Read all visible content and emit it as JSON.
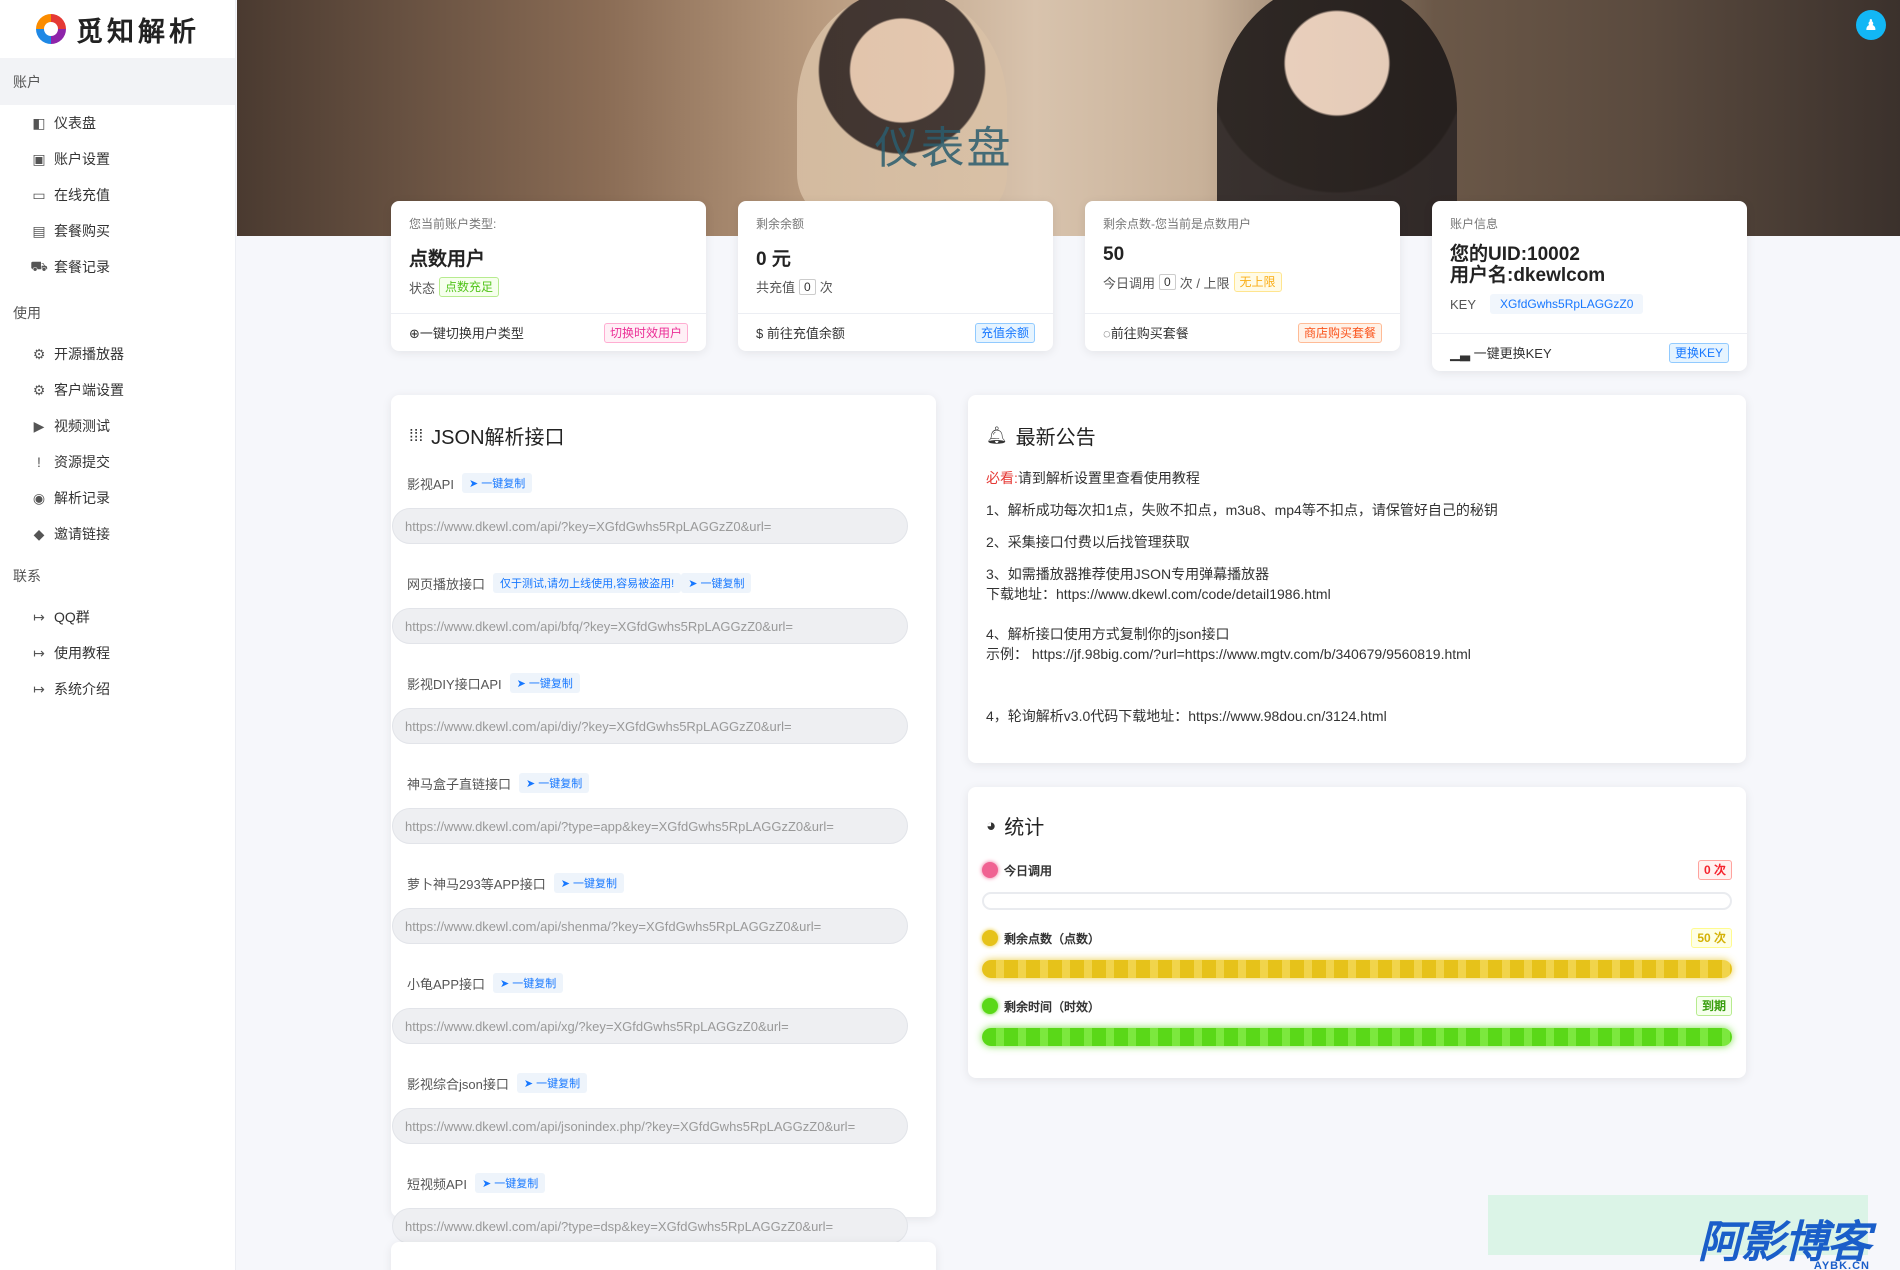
{
  "brand": {
    "name": "觅知解析"
  },
  "sidebar": {
    "sections": [
      {
        "title": "账户",
        "items": [
          {
            "label": "仪表盘",
            "icon": "dashboard-icon",
            "glyph": "◧"
          },
          {
            "label": "账户设置",
            "icon": "user-icon",
            "glyph": "▣"
          },
          {
            "label": "在线充值",
            "icon": "credit-card-icon",
            "glyph": "▭"
          },
          {
            "label": "套餐购买",
            "icon": "shopping-bag-icon",
            "glyph": "▤"
          },
          {
            "label": "套餐记录",
            "icon": "cart-icon",
            "glyph": "⛟"
          }
        ]
      },
      {
        "title": "使用",
        "items": [
          {
            "label": "开源播放器",
            "icon": "gear-icon",
            "glyph": "⚙"
          },
          {
            "label": "客户端设置",
            "icon": "gear-icon",
            "glyph": "⚙"
          },
          {
            "label": "视频测试",
            "icon": "play-icon",
            "glyph": "▶"
          },
          {
            "label": "资源提交",
            "icon": "message-alert-icon",
            "glyph": "!"
          },
          {
            "label": "解析记录",
            "icon": "eye-icon",
            "glyph": "◉"
          },
          {
            "label": "邀请链接",
            "icon": "tag-icon",
            "glyph": "◆"
          }
        ]
      },
      {
        "title": "联系",
        "items": [
          {
            "label": "QQ群",
            "icon": "login-icon",
            "glyph": "↦"
          },
          {
            "label": "使用教程",
            "icon": "login-icon",
            "glyph": "↦"
          },
          {
            "label": "系统介绍",
            "icon": "login-icon",
            "glyph": "↦"
          }
        ]
      }
    ]
  },
  "hero": {
    "title": "仪表盘"
  },
  "cards": {
    "type": {
      "label": "您当前账户类型:",
      "value": "点数用户",
      "status_label": "状态",
      "status_badge": "点数充足",
      "action": "一键切换用户类型",
      "action_badge": "切换时效用户"
    },
    "balance": {
      "label": "剩余余额",
      "value": "0 元",
      "sub_prefix": "共充值",
      "sub_count": "0",
      "sub_suffix": "次",
      "action": "前往充值余额",
      "action_badge": "充值余额"
    },
    "points": {
      "label": "剩余点数-您当前是点数用户",
      "value": "50",
      "sub_prefix": "今日调用",
      "sub_count": "0",
      "sub_suffix": "次 / 上限",
      "limit_badge": "无上限",
      "action": "前往购买套餐",
      "action_badge": "商店购买套餐"
    },
    "account": {
      "label": "账户信息",
      "uid": "您的UID:10002",
      "username": "用户名:dkewlcom",
      "key_label": "KEY",
      "key_value": "XGfdGwhs5RpLAGGzZ0",
      "action": "一键更换KEY",
      "action_badge": "更换KEY"
    }
  },
  "json_panel": {
    "title": "JSON解析接口",
    "copy_label": "一键复制",
    "apis": [
      {
        "name": "影视API",
        "warning": "",
        "url": "https://www.dkewl.com/api/?key=XGfdGwhs5RpLAGGzZ0&url="
      },
      {
        "name": "网页播放接口",
        "warning": "仅于测试,请勿上线使用,容易被盗用!",
        "url": "https://www.dkewl.com/api/bfq/?key=XGfdGwhs5RpLAGGzZ0&url="
      },
      {
        "name": "影视DIY接口API",
        "warning": "",
        "url": "https://www.dkewl.com/api/diy/?key=XGfdGwhs5RpLAGGzZ0&url="
      },
      {
        "name": "神马盒子直链接口",
        "warning": "",
        "url": "https://www.dkewl.com/api/?type=app&key=XGfdGwhs5RpLAGGzZ0&url="
      },
      {
        "name": "萝卜神马293等APP接口",
        "warning": "",
        "url": "https://www.dkewl.com/api/shenma/?key=XGfdGwhs5RpLAGGzZ0&url="
      },
      {
        "name": "小龟APP接口",
        "warning": "",
        "url": "https://www.dkewl.com/api/xg/?key=XGfdGwhs5RpLAGGzZ0&url="
      },
      {
        "name": "影视综合json接口",
        "warning": "",
        "url": "https://www.dkewl.com/api/jsonindex.php/?key=XGfdGwhs5RpLAGGzZ0&url="
      },
      {
        "name": "短视频API",
        "warning": "",
        "url": "https://www.dkewl.com/api/?type=dsp&key=XGfdGwhs5RpLAGGzZ0&url="
      }
    ]
  },
  "notice_panel": {
    "title": "最新公告",
    "must_label": "必看:",
    "must_text": "请到解析设置里查看使用教程",
    "line1": "1、解析成功每次扣1点，失败不扣点，m3u8、mp4等不扣点，请保管好自己的秘钥",
    "line2": "2、采集接口付费以后找管理获取",
    "line3a": "3、如需播放器推荐使用JSON专用弹幕播放器",
    "line3b": "下载地址：https://www.dkewl.com/code/detail1986.html",
    "line4a": "4、解析接口使用方式复制你的json接口",
    "line4b": "示例：  https://jf.98big.com/?url=https://www.mgtv.com/b/340679/9560819.html",
    "line5": "4，轮询解析v3.0代码下载地址：https://www.98dou.cn/3124.html"
  },
  "stats_panel": {
    "title": "统计",
    "rows": [
      {
        "label": "今日调用",
        "badge": "0 次",
        "fill": 0,
        "color": "#f06292"
      },
      {
        "label": "剩余点数（点数）",
        "badge": "50 次",
        "fill": 1,
        "color": "#e6c21a"
      },
      {
        "label": "剩余时间（时效）",
        "badge": "到期",
        "fill": 1,
        "color": "#5ad818"
      }
    ]
  },
  "watermark": {
    "text": "阿影博客",
    "sub": "AYBK.CN"
  }
}
